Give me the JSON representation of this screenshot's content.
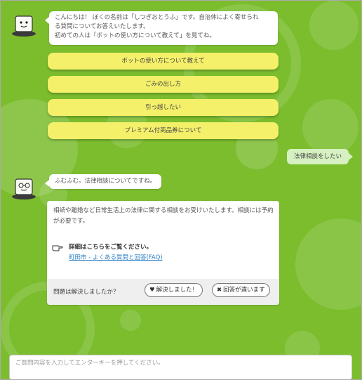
{
  "greeting": {
    "lines": [
      "こんにちは！ ぼくの名前は「しつぎおとうふ」です。自治体によく寄せられ",
      "る質問についてお答えいたします。",
      "初めての人は「ボットの使い方について教えて」を見てね。"
    ]
  },
  "quick_replies": [
    "ボットの使い方について教えて",
    "ごみの出し方",
    "引っ越したい",
    "プレミアム付商品券について"
  ],
  "user_message": "法律相談をしたい",
  "bot_reply": "ふむふむ。法律相談についてですね。",
  "answer_card": {
    "text": "相続や離婚など日常生活上の法律に関する相談をお受けいたします。相談には予約が必要です。",
    "detail_title": "詳細はこちらをご覧ください。",
    "link_text": "町田市 - よくある質問と回答(FAQ)",
    "feedback_question": "問題は解決しましたか？",
    "resolved_label": "解決しました！",
    "not_resolved_label": "回答が違います"
  },
  "input": {
    "placeholder": "ご質問内容を入力してエンターキーを押してください。",
    "value": ""
  },
  "colors": {
    "background": "#7cbd2e",
    "quick_reply": "#f4f06a",
    "user_bubble": "#d6f0c1",
    "link": "#2a7ec1"
  },
  "icons": {
    "avatar": "tofu-mascot-icon",
    "hand": "pointing-hand-icon",
    "heart": "heart-icon",
    "cross": "cross-icon"
  }
}
